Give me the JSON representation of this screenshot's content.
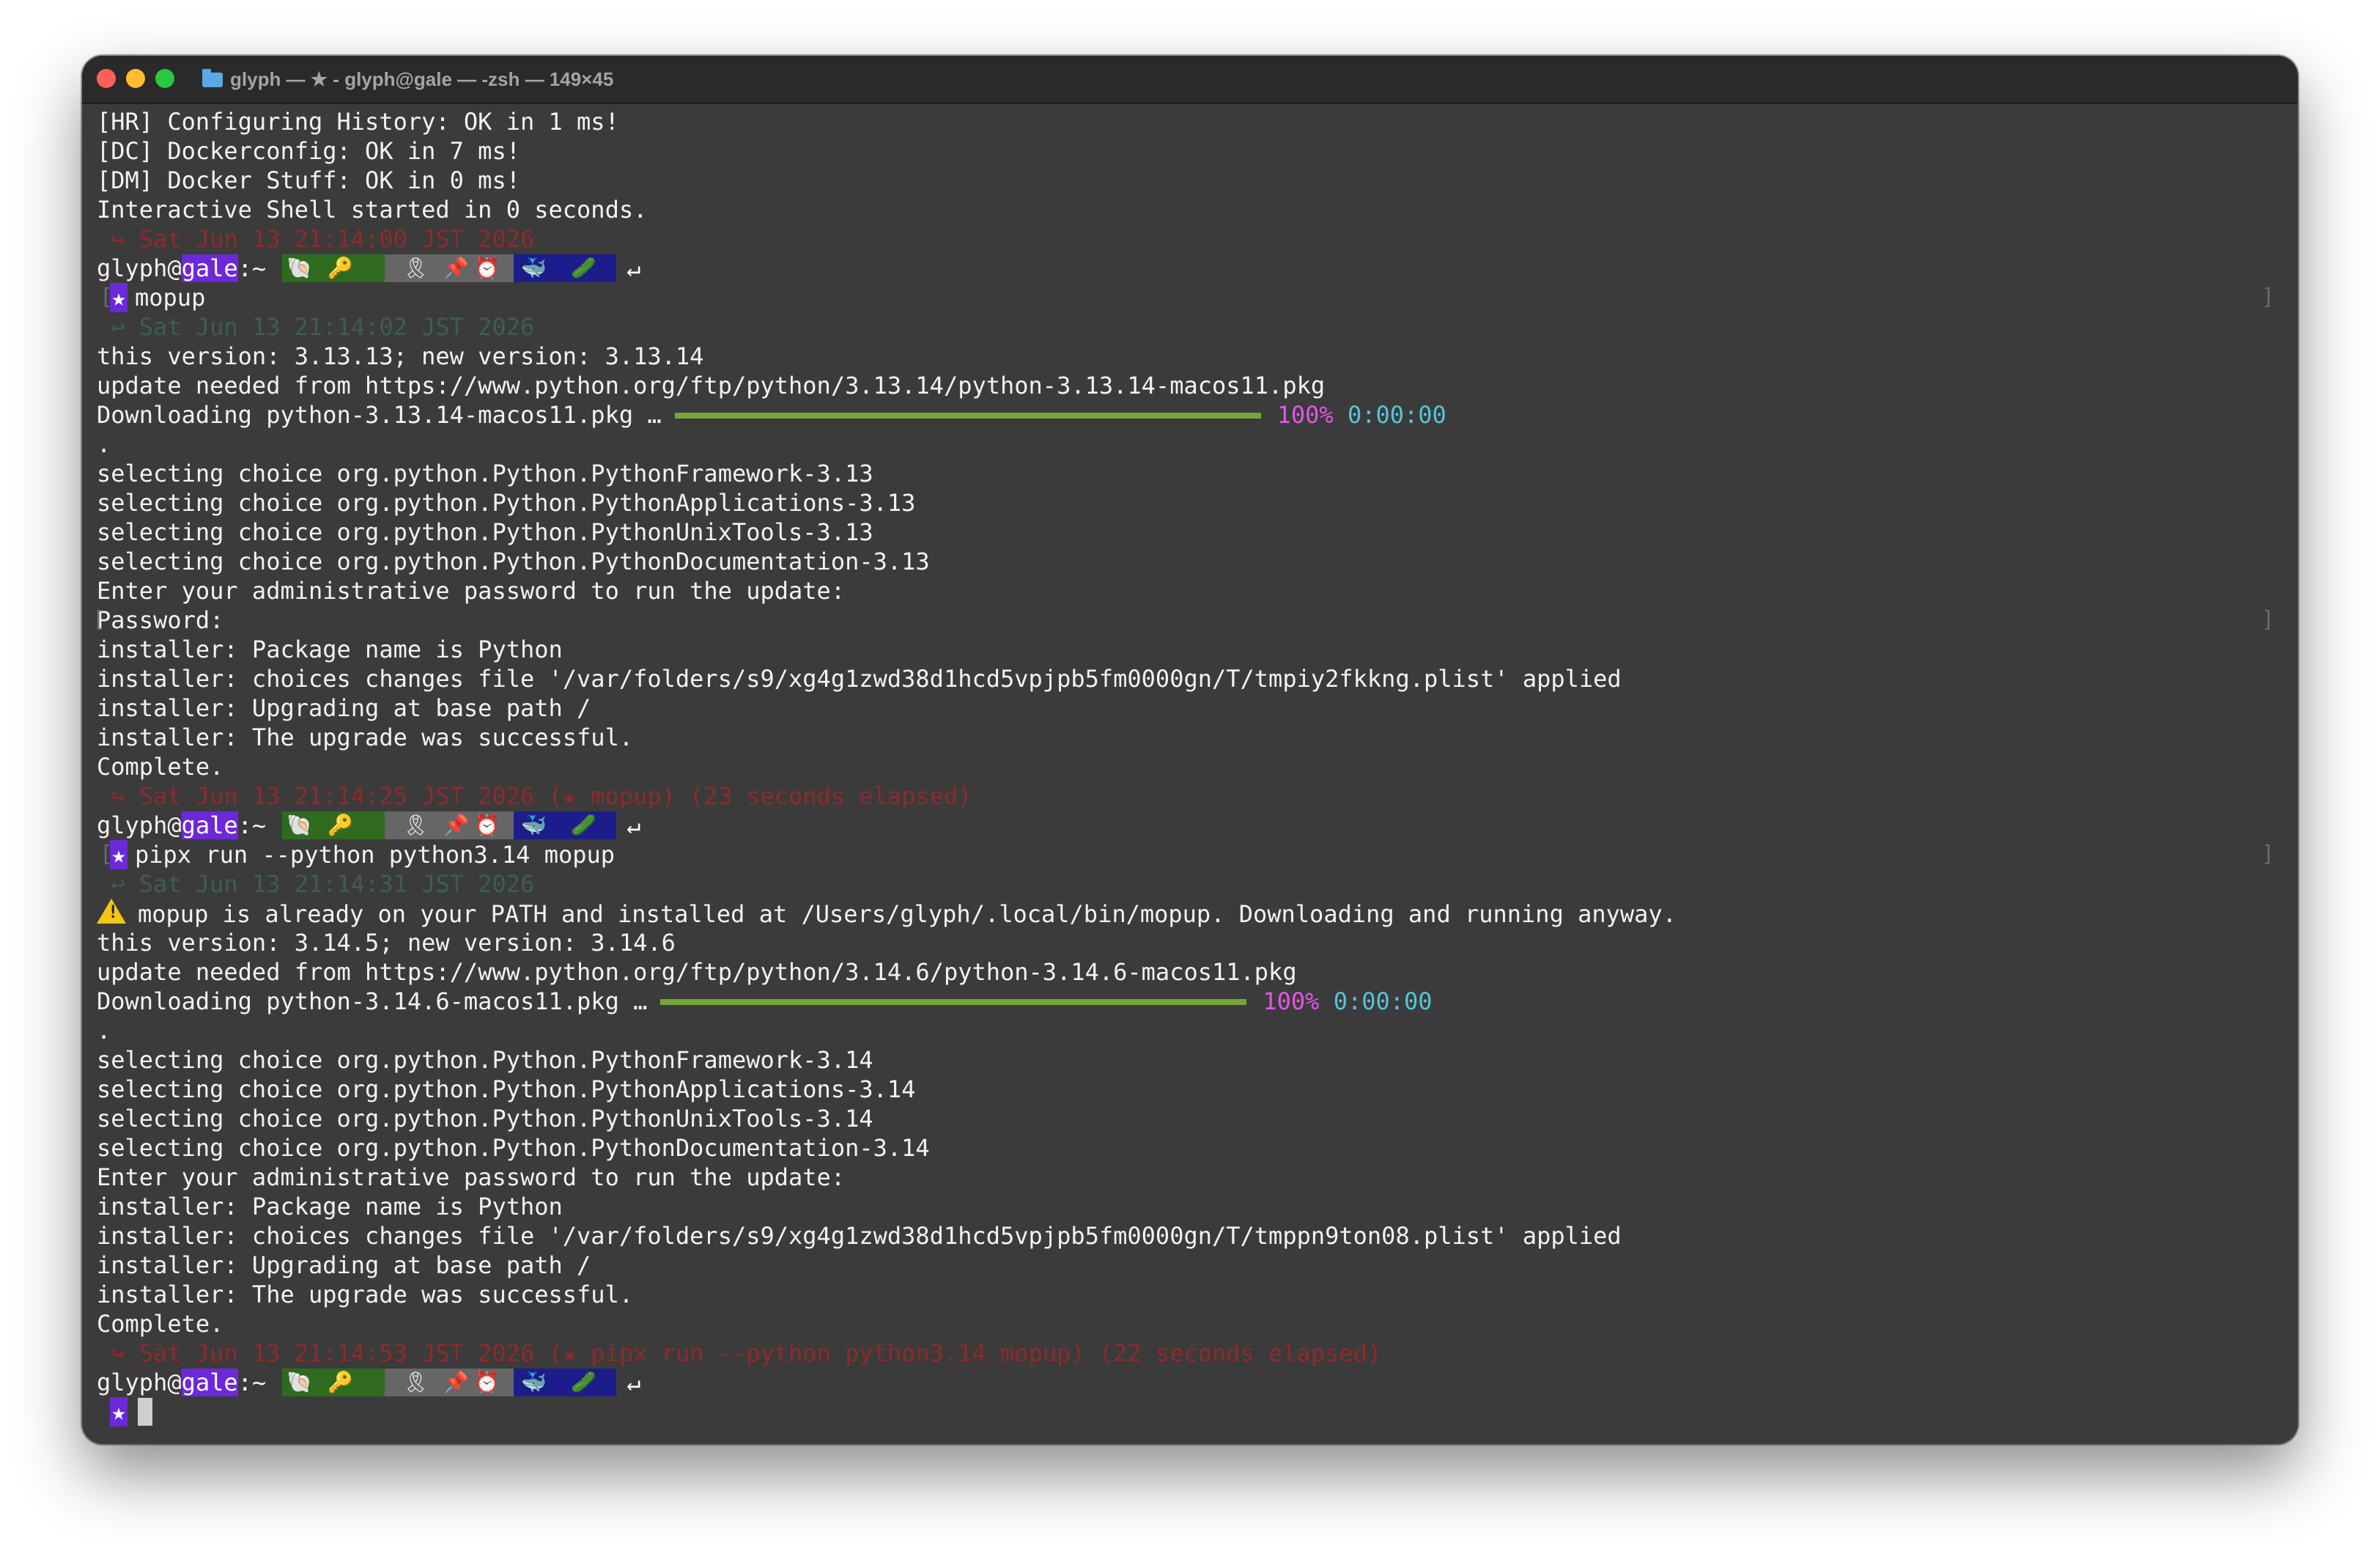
{
  "window": {
    "title": "glyph — ★ - glyph@gale — -zsh — 149×45",
    "icon": "folder-icon"
  },
  "colors": {
    "background": "#3b3b3b",
    "text": "#f2f2f2",
    "host_highlight": "#6d28d9",
    "timestamp_red": "#8f2a2a",
    "timestamp_teal": "#3c5c5a",
    "progress_bar": "#76a53a",
    "percent": "#e256e8",
    "eta": "#55c5d8"
  },
  "prompt": {
    "user": "glyph",
    "at": "@",
    "host": "gale",
    "path": ":~",
    "return_symbol": "↵",
    "star": "★",
    "segments": {
      "green": [
        "🐚",
        "🔑"
      ],
      "gray": [
        "🎗",
        "📌",
        "⏰"
      ],
      "navy": [
        "🐳",
        "🥒"
      ]
    }
  },
  "lines": {
    "l1": "[HR] Configuring History: OK in 1 ms!",
    "l2": "[DC] Dockerconfig: OK in 7 ms!",
    "l3": "[DM] Docker Stuff: OK in 0 ms!",
    "l4": "Interactive Shell started in 0 seconds.",
    "ts1": " ↪ Sat Jun 13 21:14:00 JST 2026",
    "cmd1": "mopup",
    "ts2": " ↩ Sat Jun 13 21:14:02 JST 2026",
    "a1": "this version: 3.13.13; new version: 3.13.14",
    "a2": "update needed from https://www.python.org/ftp/python/3.13.14/python-3.13.14-macos11.pkg",
    "a3": "Downloading python-3.13.14-macos11.pkg …",
    "a3_pct": "100%",
    "a3_eta": "0:00:00",
    "a4": ".",
    "a5": "selecting choice org.python.Python.PythonFramework-3.13",
    "a6": "selecting choice org.python.Python.PythonApplications-3.13",
    "a7": "selecting choice org.python.Python.PythonUnixTools-3.13",
    "a8": "selecting choice org.python.Python.PythonDocumentation-3.13",
    "a9": "Enter your administrative password to run the update:",
    "a10": "Password:",
    "a11": "installer: Package name is Python",
    "a12": "installer: choices changes file '/var/folders/s9/xg4g1zwd38d1hcd5vpjpb5fm0000gn/T/tmpiy2fkkng.plist' applied",
    "a13": "installer: Upgrading at base path /",
    "a14": "installer: The upgrade was successful.",
    "a15": "Complete.",
    "ts3": " ↪ Sat Jun 13 21:14:25 JST 2026 (★ mopup) (23 seconds elapsed)",
    "cmd2": "pipx run --python python3.14 mopup",
    "ts4": " ↩ Sat Jun 13 21:14:31 JST 2026",
    "b1": "mopup is already on your PATH and installed at /Users/glyph/.local/bin/mopup. Downloading and running anyway.",
    "b2": "this version: 3.14.5; new version: 3.14.6",
    "b3": "update needed from https://www.python.org/ftp/python/3.14.6/python-3.14.6-macos11.pkg",
    "b4": "Downloading python-3.14.6-macos11.pkg …",
    "b4_pct": "100%",
    "b4_eta": "0:00:00",
    "b5": ".",
    "b6": "selecting choice org.python.Python.PythonFramework-3.14",
    "b7": "selecting choice org.python.Python.PythonApplications-3.14",
    "b8": "selecting choice org.python.Python.PythonUnixTools-3.14",
    "b9": "selecting choice org.python.Python.PythonDocumentation-3.14",
    "b10": "Enter your administrative password to run the update:",
    "b11": "installer: Package name is Python",
    "b12": "installer: choices changes file '/var/folders/s9/xg4g1zwd38d1hcd5vpjpb5fm0000gn/T/tmppn9ton08.plist' applied",
    "b13": "installer: Upgrading at base path /",
    "b14": "installer: The upgrade was successful.",
    "b15": "Complete.",
    "ts5": " ↪ Sat Jun 13 21:14:53 JST 2026 (★ pipx run --python python3.14 mopup) (22 seconds elapsed)"
  },
  "marks": {
    "left": "[",
    "right": "]"
  },
  "progress": {
    "download1": 1.0,
    "download2": 1.0
  }
}
